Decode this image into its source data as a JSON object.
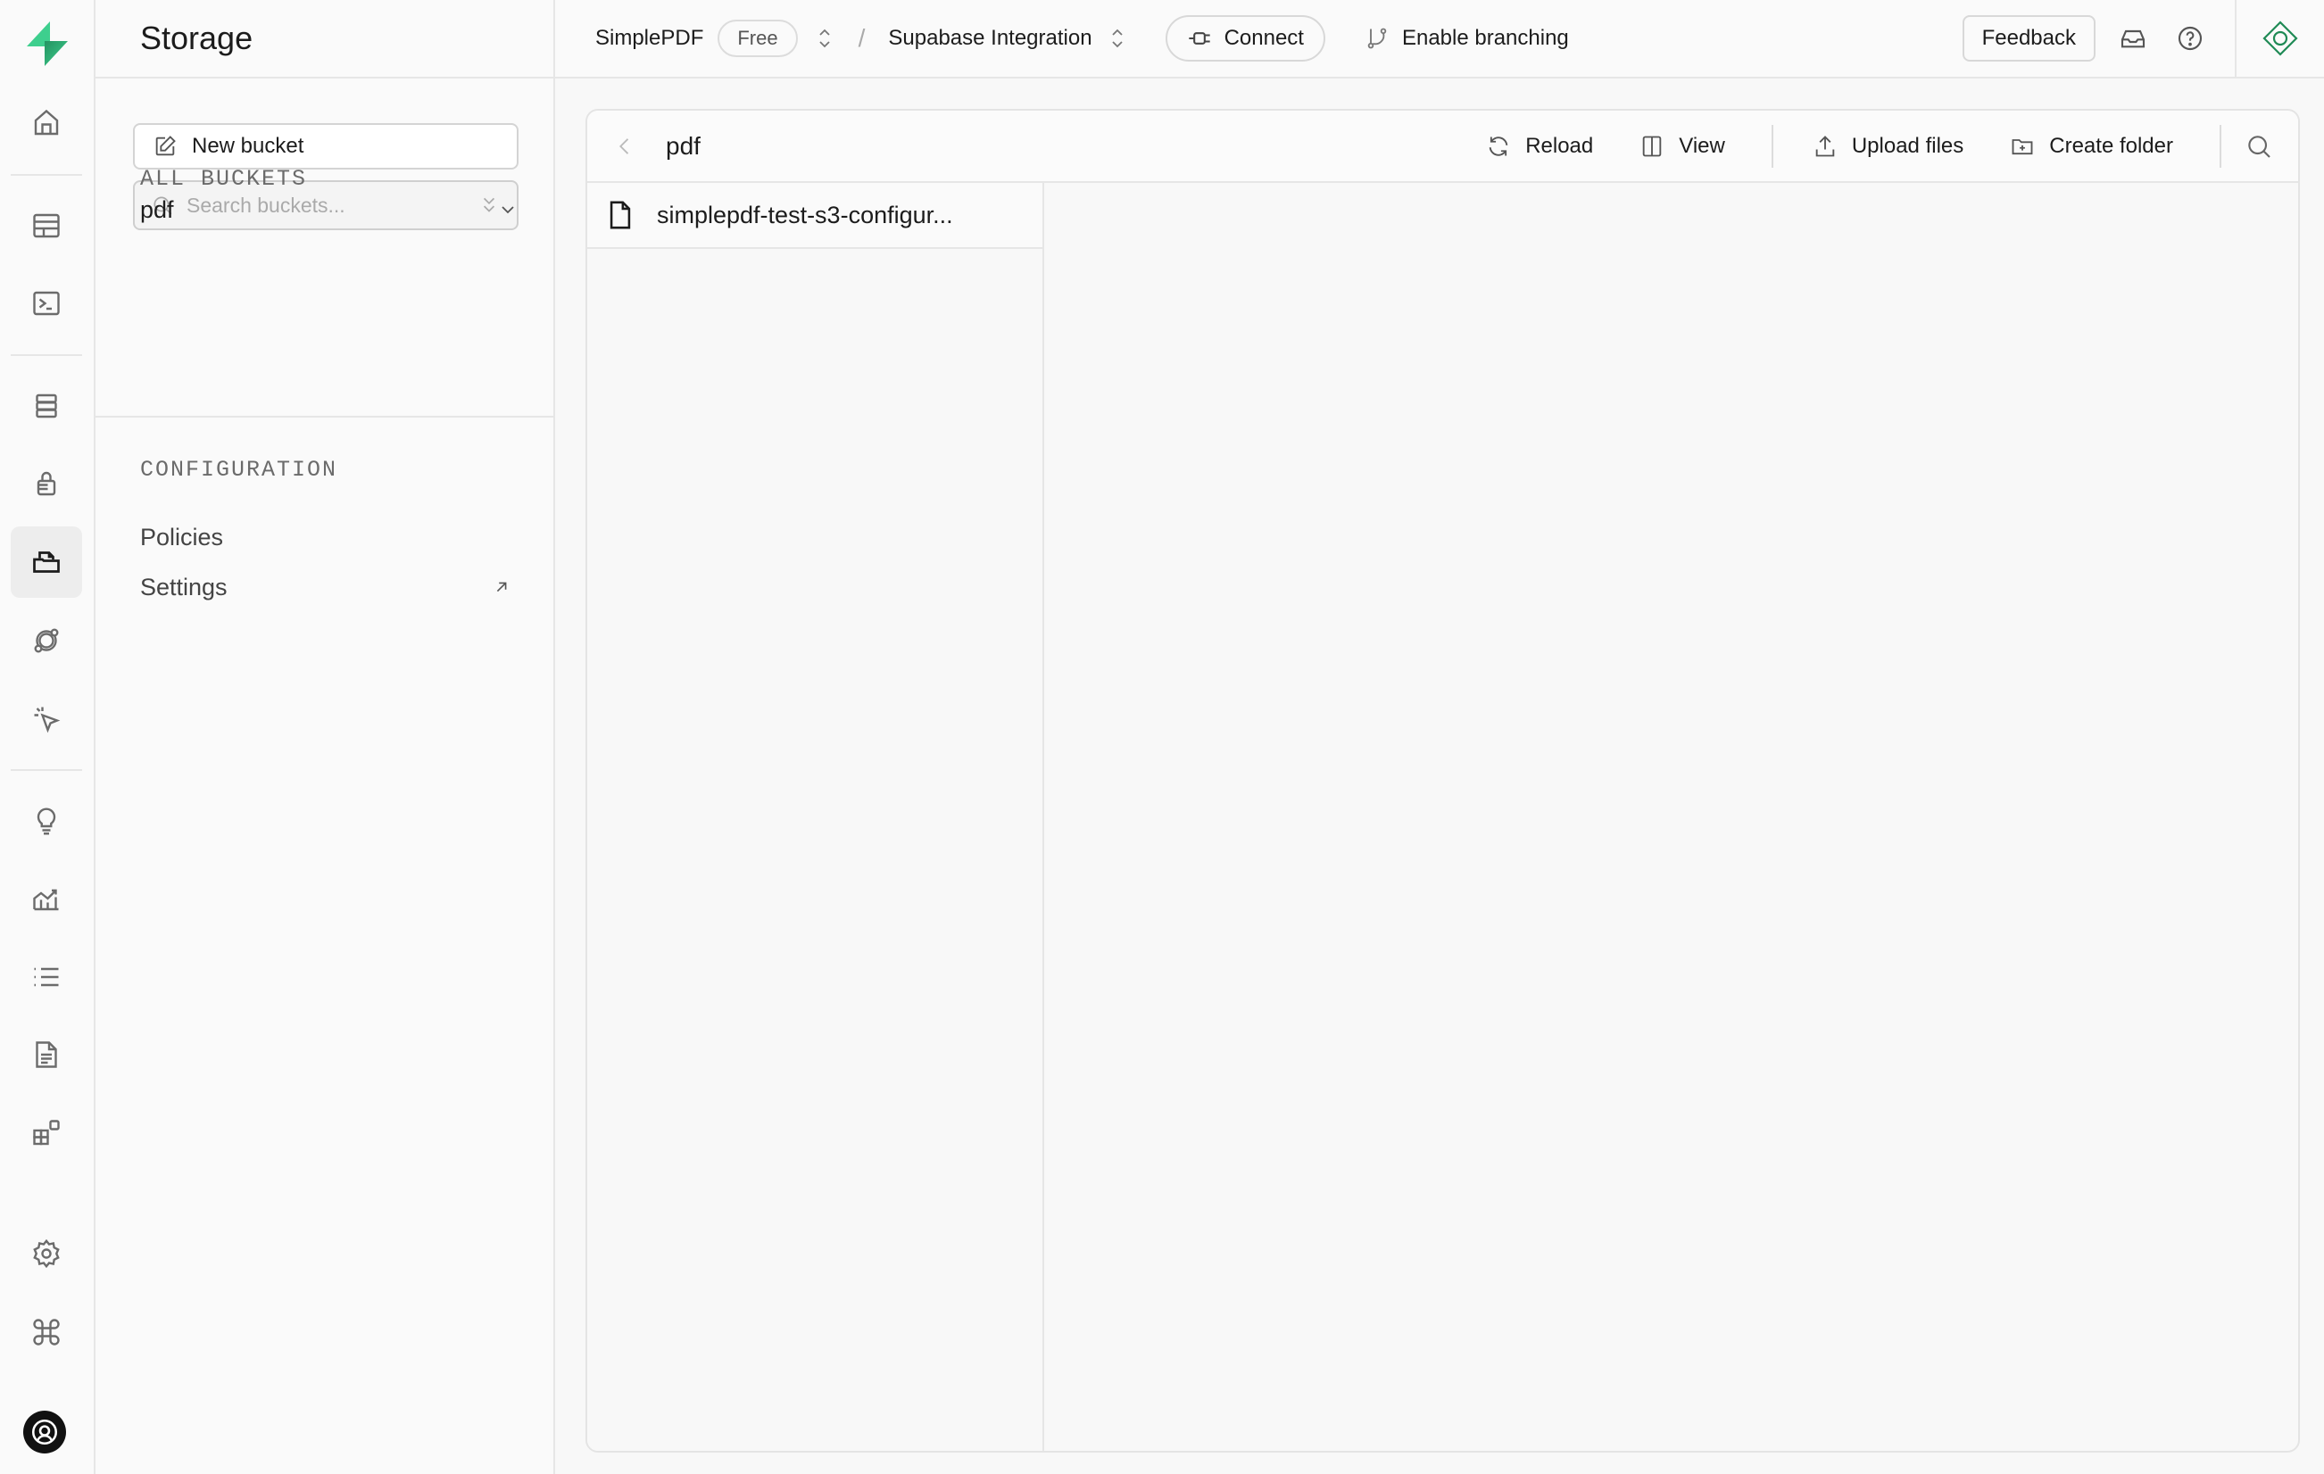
{
  "app": {
    "section_title": "Storage",
    "brand_color": "#3ecf8e"
  },
  "rail": {
    "items": [
      {
        "name": "home",
        "icon": "home-icon"
      },
      {
        "name": "table-editor",
        "icon": "table-icon"
      },
      {
        "name": "sql-editor",
        "icon": "terminal-icon"
      },
      {
        "name": "database",
        "icon": "database-icon"
      },
      {
        "name": "authentication",
        "icon": "lock-icon"
      },
      {
        "name": "storage",
        "icon": "folder-file-icon",
        "active": true
      },
      {
        "name": "edge-functions",
        "icon": "orbit-icon"
      },
      {
        "name": "realtime",
        "icon": "cursor-click-icon"
      },
      {
        "name": "advisors",
        "icon": "lightbulb-icon"
      },
      {
        "name": "reports",
        "icon": "chart-icon"
      },
      {
        "name": "logs",
        "icon": "list-icon"
      },
      {
        "name": "api-docs",
        "icon": "document-icon"
      },
      {
        "name": "integrations",
        "icon": "blocks-icon"
      },
      {
        "name": "project-settings",
        "icon": "gear-icon"
      },
      {
        "name": "command-menu",
        "icon": "command-icon"
      },
      {
        "name": "account",
        "icon": "avatar-icon"
      }
    ]
  },
  "topbar": {
    "org_name": "SimplePDF",
    "plan_badge": "Free",
    "separator": "/",
    "project_name": "Supabase Integration",
    "connect_label": "Connect",
    "branching_label": "Enable branching",
    "feedback_label": "Feedback"
  },
  "sidebar": {
    "new_bucket_label": "New bucket",
    "search_placeholder": "Search buckets...",
    "search_value": "",
    "all_buckets_heading": "ALL BUCKETS",
    "buckets": [
      {
        "name": "pdf"
      }
    ],
    "configuration_heading": "CONFIGURATION",
    "config_items": [
      {
        "label": "Policies",
        "external": false
      },
      {
        "label": "Settings",
        "external": true
      }
    ]
  },
  "explorer": {
    "current_path": "pdf",
    "actions": {
      "reload": "Reload",
      "view": "View",
      "upload": "Upload files",
      "create_folder": "Create folder"
    },
    "files": [
      {
        "name": "simplepdf-test-s3-configur...",
        "type": "file"
      }
    ]
  }
}
